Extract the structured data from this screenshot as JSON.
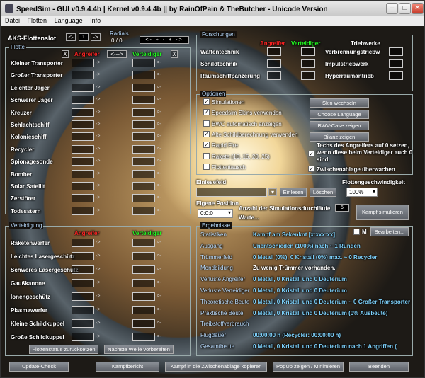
{
  "window": {
    "title": "SpeedSim - GUI v0.9.4.4b | Kernel v0.9.4.4b || by RainOfPain & TheButcher - Unicode Version"
  },
  "menu": [
    "Datei",
    "Flotten",
    "Language",
    "Info"
  ],
  "aks": {
    "label": "AKS-Flottenslot",
    "value": "1",
    "prev": "<-",
    "next": "->"
  },
  "radials": {
    "label": "Radials",
    "value": "0 / 0"
  },
  "fleet": {
    "title": "Flotte",
    "attacker": "Angreifer",
    "defender": "Verteidiger",
    "clear": "X",
    "copy": "<--->",
    "items": [
      "Kleiner Transporter",
      "Großer Transporter",
      "Leichter Jäger",
      "Schwerer Jäger",
      "Kreuzer",
      "Schlachtschiff",
      "Kolonieschiff",
      "Recycler",
      "Spionagesonde",
      "Bomber",
      "Solar Satellit",
      "Zerstörer",
      "Todesstern"
    ]
  },
  "defense": {
    "title": "Verteidigung",
    "attacker": "Angreifer",
    "defender": "Verteidiger",
    "items": [
      "Raketenwerfer",
      "Leichtes Lasergeschütz",
      "Schweres Lasergeschütz",
      "Gaußkanone",
      "Ionengeschütz",
      "Plasmawerfer",
      "Kleine Schildkuppel",
      "Große Schildkuppel"
    ],
    "btn_restore": "Flottenstatus zurücksetzen",
    "btn_next_wave": "Nächste Welle vorbereiten"
  },
  "research": {
    "title": "Forschungen",
    "attacker": "Angreifer",
    "defender": "Verteidiger",
    "engines_title": "Triebwerke",
    "items": [
      "Waffentechnik",
      "Schildtechnik",
      "Raumschiffpanzerung"
    ],
    "engines": [
      "Verbrennungstriebw",
      "Impulstriebwerk",
      "Hyperraumantrieb"
    ]
  },
  "options": {
    "title": "Optionen",
    "checks": [
      {
        "label": "Simulationen",
        "checked": true
      },
      {
        "label": "Speedsim Skins verwenden",
        "checked": true
      },
      {
        "label": "BWC automatisch anzeigen",
        "checked": false
      },
      {
        "label": "Alte Schildberechnung verwenden",
        "checked": true
      },
      {
        "label": "Rapid Fire",
        "checked": true
      },
      {
        "label": "Rakete (10, 15, 20, 25)",
        "checked": false
      },
      {
        "label": "Flottentausch",
        "checked": false
      }
    ],
    "buttons": [
      "Skin wechseln",
      "Choose Language",
      "BWV-Case zeigen",
      "Bilanz zeigen"
    ],
    "note": "Techs des Angreifers auf 0 setzen, wenn diese beim Verteidiger auch 0 sind.",
    "note_checked": true,
    "clipboard": "Zwischenablage überwachen",
    "clipboard_checked": true
  },
  "readin": {
    "title": "Einlesefeld",
    "read": "Einlesen",
    "delete": "Löschen"
  },
  "speed": {
    "title": "Flottengeschwindigkeit",
    "value": "100%"
  },
  "position": {
    "title": "Eigene Position",
    "value": "0:0:0",
    "sims_label": "Anzahl der Simulationsdurchläufe",
    "sims_value": "5",
    "wait": "Warte...",
    "simulate": "Kampf simulieren"
  },
  "results": {
    "title": "Ergebnisse",
    "edit": "Bearbeiten...",
    "m": "M",
    "rows": [
      {
        "k": "Statistiken",
        "v": "Kampf am Sekenknt [x:xxx:xx]"
      },
      {
        "k": "Ausgang",
        "v": "Unentschieden (100%) nach ~ 1 Runden"
      },
      {
        "k": "Trümmerfeld",
        "v": "0 Metall (0%), 0 Kristall (0%) max. ~ 0 Recycler"
      },
      {
        "k": "Mondbildung",
        "v": "Zu wenig Trümmer vorhanden."
      },
      {
        "k": "Verluste Angreifer",
        "v": "0 Metall, 0 Kristall und 0 Deuterium"
      },
      {
        "k": "Verluste Verteidiger",
        "v": "0 Metall, 0 Kristall und 0 Deuterium"
      },
      {
        "k": "Theoretische Beute",
        "v": "0 Metall, 0 Kristall und 0 Deuterium ~ 0 Großer Transporter"
      },
      {
        "k": "Praktische Beute",
        "v": "0 Metall, 0 Kristall und 0 Deuterium (0% Ausbeute)"
      },
      {
        "k": "Treibstoffverbrauch",
        "v": ""
      },
      {
        "k": "Flugdauer",
        "v": "00:00:00 h (Recycler: 00:00:00 h)"
      },
      {
        "k": "Gesamtbeute",
        "v": "0 Metall, 0 Kristall und 0 Deuterium nach 1 Angriffen ("
      }
    ]
  },
  "bottom": [
    "Update-Check",
    "Kampfbericht",
    "Kampf in die Zwischenablage kopieren",
    "PopUp zeigen / Minimieren",
    "Beenden"
  ],
  "colors": {
    "accent_red": "#ff2020",
    "accent_green": "#20ff20",
    "result_blue": "#7fd4ff"
  }
}
